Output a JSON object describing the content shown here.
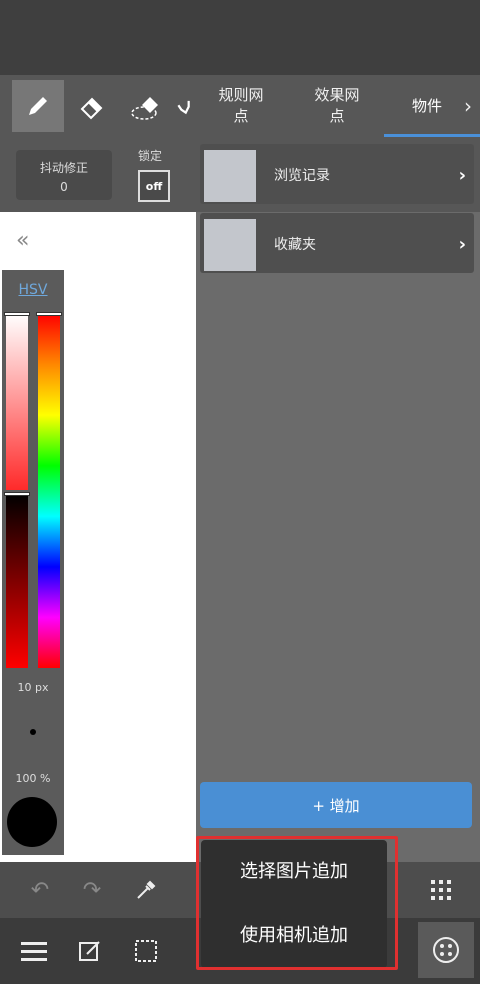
{
  "toolbar": {
    "tools": [
      "pen-icon",
      "eraser-icon",
      "selection-eraser-icon",
      "hand-icon"
    ]
  },
  "tabs": {
    "items": [
      {
        "label": "规则网\n点",
        "active": false
      },
      {
        "label": "效果网\n点",
        "active": false
      },
      {
        "label": "物件",
        "active": true
      }
    ]
  },
  "settings": {
    "stabilizer_label": "抖动修正",
    "stabilizer_value": "0",
    "lock_label": "锁定",
    "lock_value": "off"
  },
  "colorpanel": {
    "mode": "HSV",
    "size": "10 px",
    "opacity": "100 %",
    "current_color": "#000000"
  },
  "materials": {
    "rows": [
      {
        "label": "浏览记录"
      },
      {
        "label": "收藏夹"
      }
    ],
    "add_label": "+ 增加"
  },
  "popup": {
    "items": [
      "选择图片追加",
      "使用相机追加"
    ]
  },
  "colors": {
    "accent": "#4a8fd4",
    "highlight": "#e03030"
  }
}
